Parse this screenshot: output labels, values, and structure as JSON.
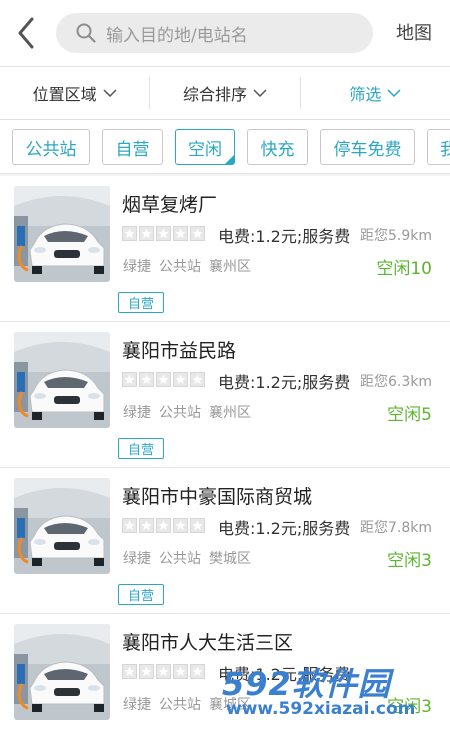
{
  "header": {
    "search_placeholder": "输入目的地/电站名",
    "map_label": "地图"
  },
  "filters": [
    "位置区域",
    "综合排序",
    "筛选"
  ],
  "chips": [
    "公共站",
    "自营",
    "空闲",
    "快充",
    "停车免费",
    "我"
  ],
  "chips_active_index": 2,
  "stations": [
    {
      "name": "烟草复烤厂",
      "fee": "电费:1.2元;服务费",
      "distance": "距您5.9km",
      "operator": "绿捷",
      "type": "公共站",
      "district": "襄州区",
      "availability": "空闲10",
      "badge": "自营",
      "rating": 0
    },
    {
      "name": "襄阳市益民路",
      "fee": "电费:1.2元;服务费",
      "distance": "距您6.3km",
      "operator": "绿捷",
      "type": "公共站",
      "district": "襄州区",
      "availability": "空闲5",
      "badge": "自营",
      "rating": 0
    },
    {
      "name": "襄阳市中豪国际商贸城",
      "fee": "电费:1.2元;服务费",
      "distance": "距您7.8km",
      "operator": "绿捷",
      "type": "公共站",
      "district": "樊城区",
      "availability": "空闲3",
      "badge": "自营",
      "rating": 0
    },
    {
      "name": "襄阳市人大生活三区",
      "fee": "电费:1.2元;服务费",
      "distance": "",
      "operator": "绿捷",
      "type": "公共站",
      "district": "襄城区",
      "availability": "空闲3",
      "badge": "",
      "rating": 0
    }
  ],
  "watermark": {
    "logo": "592软件园",
    "url": "www.592xiazai.com"
  },
  "colors": {
    "accent": "#2ba7c4",
    "available": "#5cb531",
    "muted": "#999999"
  }
}
